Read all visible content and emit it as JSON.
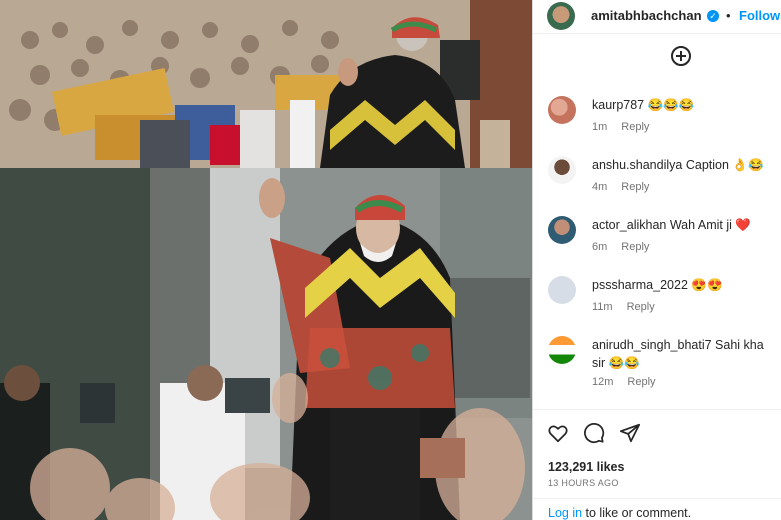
{
  "post": {
    "username": "amitabhbachchan",
    "follow_label": "Follow",
    "likes": "123,291 likes",
    "time_ago": "13 HOURS AGO",
    "login_link": "Log in",
    "login_rest": " to like or comment."
  },
  "comments": [
    {
      "user": "kaurp787",
      "text": "😂😂😂",
      "time": "1m",
      "reply": "Reply"
    },
    {
      "user": "anshu.shandilya",
      "text": "Caption 👌😂",
      "time": "4m",
      "reply": "Reply"
    },
    {
      "user": "actor_alikhan",
      "text": "Wah Amit ji ❤️",
      "time": "6m",
      "reply": "Reply"
    },
    {
      "user": "psssharma_2022",
      "text": "😍😍",
      "time": "11m",
      "reply": "Reply"
    },
    {
      "user": "anirudh_singh_bhati7",
      "text": "Sahi kha sir 😂😂",
      "time": "12m",
      "reply": "Reply"
    }
  ],
  "icons": [
    "verified-badge-icon",
    "add-comment-icon",
    "heart-icon",
    "comment-icon",
    "share-icon"
  ]
}
